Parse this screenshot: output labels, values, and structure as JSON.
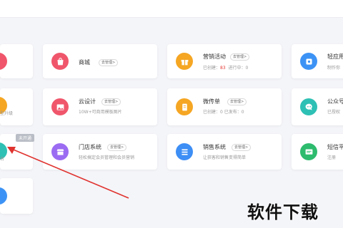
{
  "colors": {
    "accent_red": "#e53935",
    "arrow_red": "#e0332f",
    "mall": "#f0566b",
    "marketing": "#f5a623",
    "light_app": "#3d93f5",
    "cloud_design": "#f0566b",
    "weichuandan": "#f5a623",
    "public_account": "#2ec0b4",
    "store_system": "#9b6cf2",
    "sales_system": "#3d8ef5",
    "sms": "#2dbb6e"
  },
  "left_column": {
    "row2_desc": "型升级",
    "row3_badge": "未开通",
    "row3_desc": "名"
  },
  "cards": {
    "mall": {
      "icon": "bag-icon",
      "title": "商城",
      "tag": "去管理>"
    },
    "marketing": {
      "icon": "gift-icon",
      "title": "营销活动",
      "tag": "去管理>",
      "created_label": "已创建：",
      "created_value": "83",
      "in_progress": "进行中：0"
    },
    "light_app": {
      "icon": "app-icon",
      "title": "轻应用",
      "desc": "制作你"
    },
    "cloud_design": {
      "icon": "image-icon",
      "title": "云设计",
      "tag": "去管理>",
      "desc": "10W+可商用模板图片"
    },
    "weichuandan": {
      "icon": "document-icon",
      "title": "微传单",
      "tag": "去管理>",
      "desc": "已创建：0  已发布：0"
    },
    "public_account": {
      "icon": "chat-icon",
      "title": "公众号",
      "desc": "已授权"
    },
    "store_system": {
      "icon": "store-icon",
      "title": "门店系统",
      "tag": "去管理>",
      "desc": "轻松搞定会员管理和会员营销"
    },
    "sales_system": {
      "icon": "list-icon",
      "title": "销售系统",
      "tag": "去管理>",
      "desc": "让获客和销售变得简单"
    },
    "sms": {
      "icon": "message-icon",
      "title": "短信平",
      "desc": "注册"
    }
  },
  "watermark": "软件下载"
}
